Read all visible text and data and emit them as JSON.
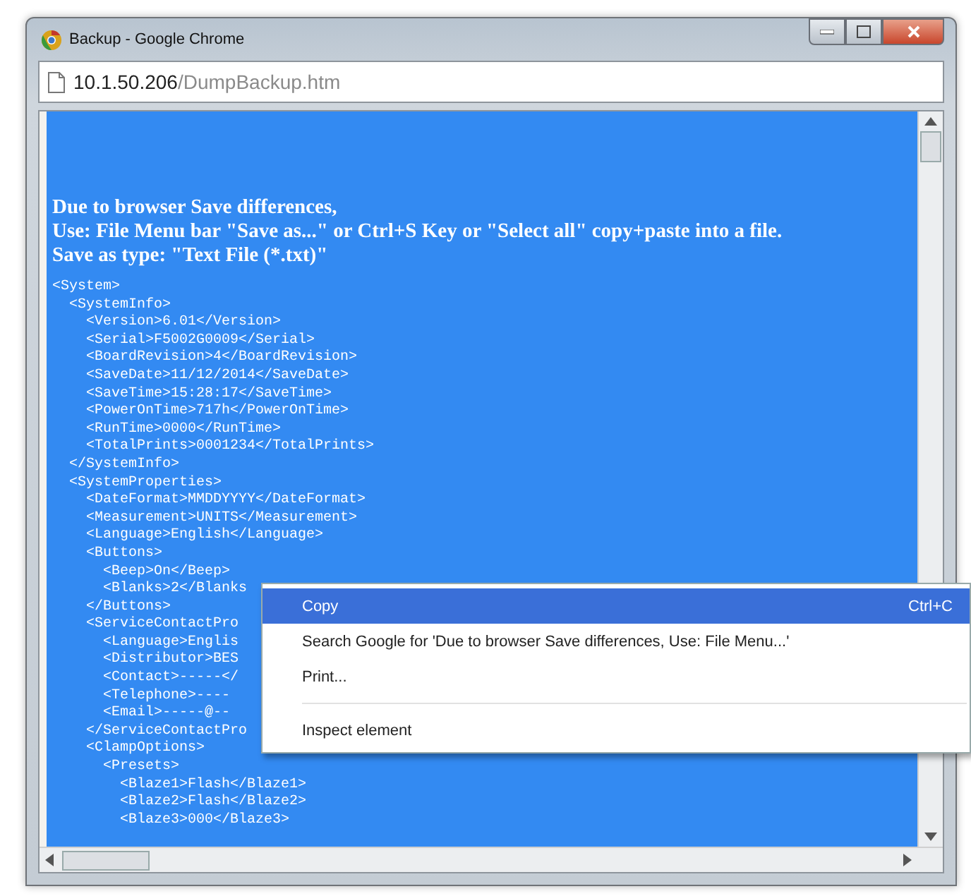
{
  "window": {
    "title": "Backup - Google Chrome"
  },
  "address_bar": {
    "host": "10.1.50.206",
    "path": "/DumpBackup.htm"
  },
  "page": {
    "notice_lines": [
      "Due to browser Save differences,",
      "Use: File Menu bar \"Save as...\" or Ctrl+S Key or \"Select all\" copy+paste into a file.",
      "Save as type: \"Text File (*.txt)\""
    ],
    "listing": [
      {
        "text": "<System>",
        "children": [
          {
            "text": "<SystemInfo>",
            "children": [
              {
                "text": "<Version>6.01</Version>"
              },
              {
                "text": "<Serial>F5002G0009</Serial>"
              },
              {
                "text": "<BoardRevision>4</BoardRevision>"
              },
              {
                "text": "<SaveDate>11/12/2014</SaveDate>"
              },
              {
                "text": "<SaveTime>15:28:17</SaveTime>"
              },
              {
                "text": "<PowerOnTime>717h</PowerOnTime>"
              },
              {
                "text": "<RunTime>0000</RunTime>"
              },
              {
                "text": "<TotalPrints>0001234</TotalPrints>"
              }
            ]
          },
          {
            "text": "</SystemInfo>"
          },
          {
            "text": "<SystemProperties>",
            "children": [
              {
                "text": "<DateFormat>MMDDYYYY</DateFormat>"
              },
              {
                "text": "<Measurement>UNITS</Measurement>"
              },
              {
                "text": "<Language>English</Language>"
              },
              {
                "text": "<Buttons>",
                "children": [
                  {
                    "text": "<Beep>On</Beep>"
                  },
                  {
                    "text": "<Blanks>2</Blanks"
                  }
                ]
              },
              {
                "text": "</Buttons>"
              },
              {
                "text": "<ServiceContactPro",
                "children": [
                  {
                    "text": "<Language>Englis"
                  },
                  {
                    "text": "<Distributor>BES"
                  },
                  {
                    "text": "<Contact>-----</"
                  },
                  {
                    "text": "<Telephone>----"
                  },
                  {
                    "text": "<Email>-----@--"
                  }
                ]
              },
              {
                "text": "</ServiceContactPro"
              },
              {
                "text": "<ClampOptions>",
                "children": [
                  {
                    "text": "<Presets>",
                    "children": [
                      {
                        "text": "<Blaze1>Flash</Blaze1>"
                      },
                      {
                        "text": "<Blaze2>Flash</Blaze2>"
                      },
                      {
                        "text": "<Blaze3>000</Blaze3>"
                      }
                    ]
                  }
                ]
              }
            ]
          }
        ]
      }
    ]
  },
  "context_menu": {
    "items": [
      {
        "kind": "item",
        "label": "Copy",
        "shortcut": "Ctrl+C",
        "selected": true
      },
      {
        "kind": "item",
        "label": "Search Google for 'Due to browser Save differences, Use: File Menu...'",
        "selected": false
      },
      {
        "kind": "item",
        "label": "Print...",
        "selected": false
      },
      {
        "kind": "separator"
      },
      {
        "kind": "item",
        "label": "Inspect element",
        "selected": false
      }
    ]
  }
}
